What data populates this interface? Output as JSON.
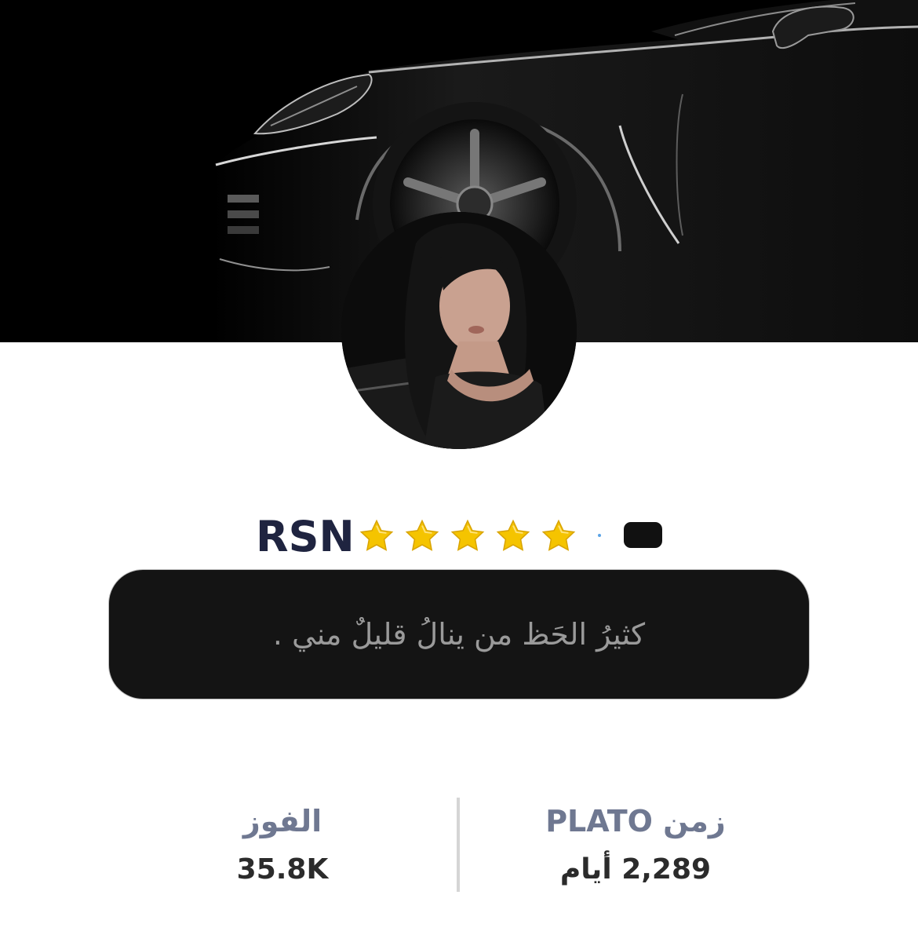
{
  "profile": {
    "name": "RSN",
    "rating_stars": 5,
    "bio": "كثيرُ الحَظ من ينالُ قليلٌ مني ."
  },
  "stats": {
    "wins": {
      "label": "الفوز",
      "value": "35.8K"
    },
    "plato_time": {
      "label": "زمن PLATO",
      "value": "2,289 أيام"
    }
  },
  "colors": {
    "name": "#1f2440",
    "star": "#f5c400",
    "bio_bg": "#141414",
    "bio_text": "#9a9a9a",
    "stat_label": "#6f7891",
    "stat_value": "#2b2b2b"
  },
  "icons": {
    "rating": "star-icon",
    "badge": "badge-icon"
  }
}
